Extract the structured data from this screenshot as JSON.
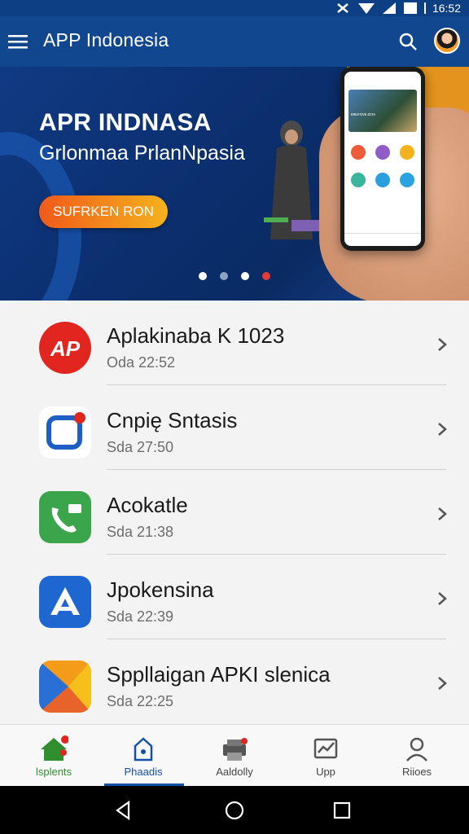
{
  "status": {
    "time": "16:52"
  },
  "app_bar": {
    "title": "APP Indonesia"
  },
  "banner": {
    "title": "APR INDNASA",
    "subtitle": "Grlonmaa PrlanNpasia",
    "cta_label": "SUFRKEN RON",
    "phone_caption": "ᴋʀᴇᴀᴛɪᴠᴇ ᴅɪᴛᴀ",
    "dots": [
      "inactive",
      "dim",
      "inactive",
      "active"
    ]
  },
  "list": {
    "items": [
      {
        "title": "Aplakinaba K 1023",
        "subtitle": "Oda 22:52",
        "icon": "ap-logo-icon",
        "color": "#e0261f"
      },
      {
        "title": "Cnpię Sntasis",
        "subtitle": "Sda 27:50",
        "icon": "rounded-square-pin-icon",
        "color": "#1d5fc4"
      },
      {
        "title": "Acokatle",
        "subtitle": "Sda 21:38",
        "icon": "phone-chat-icon",
        "color": "#3aa54a"
      },
      {
        "title": "Jpokensina",
        "subtitle": "Sda 22:39",
        "icon": "letter-a-icon",
        "color": "#1e66d0"
      },
      {
        "title": "Sppllaigan APKI slenica",
        "subtitle": "Sda 22:25",
        "icon": "play-triangle-icon",
        "color": "#f59b1a"
      }
    ]
  },
  "bottom_nav": {
    "items": [
      {
        "label": "lsplents",
        "icon": "home-icon",
        "color": "#2f8f2f"
      },
      {
        "label": "Phaadis",
        "icon": "house-outline-icon",
        "color": "#1450a8"
      },
      {
        "label": "Aaldolly",
        "icon": "printer-icon",
        "color": "#444444"
      },
      {
        "label": "Upp",
        "icon": "chart-icon",
        "color": "#444444"
      },
      {
        "label": "Riioes",
        "icon": "person-icon",
        "color": "#444444"
      }
    ],
    "active_index": 1
  }
}
